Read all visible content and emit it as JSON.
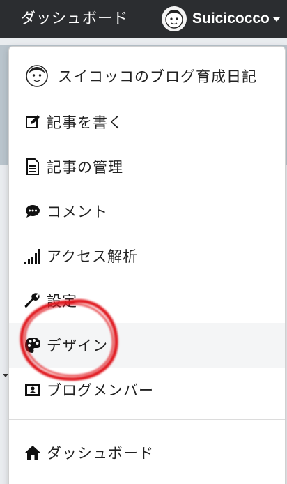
{
  "topbar": {
    "dashboard_label": "ダッシュボード",
    "username": "Suicicocco"
  },
  "menu": {
    "items": [
      {
        "label": "スイコッコのブログ育成日記",
        "icon": "avatar-face-icon"
      },
      {
        "label": "記事を書く",
        "icon": "pencil-square-icon"
      },
      {
        "label": "記事の管理",
        "icon": "document-icon"
      },
      {
        "label": "コメント",
        "icon": "comment-bubble-icon"
      },
      {
        "label": "アクセス解析",
        "icon": "signal-bars-icon"
      },
      {
        "label": "設定",
        "icon": "wrench-icon"
      },
      {
        "label": "デザイン",
        "icon": "palette-icon"
      },
      {
        "label": "ブログメンバー",
        "icon": "member-card-icon"
      },
      {
        "label": "ダッシュボード",
        "icon": "home-icon"
      }
    ],
    "active_item": "デザイン"
  },
  "colors": {
    "topbar_bg": "#2b2d30",
    "highlight_circle": "#e0141c",
    "active_row_bg": "#f4f5f6"
  }
}
